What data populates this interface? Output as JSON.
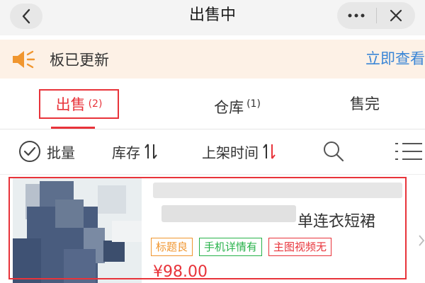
{
  "header": {
    "title": "出售中",
    "back_icon": "chevron-left-icon",
    "more_icon": "more-dots-icon",
    "close_icon": "close-icon"
  },
  "notice": {
    "icon": "speaker-icon",
    "text": "板已更新",
    "link": "立即查看",
    "icon_color": "#f0962f",
    "link_color": "#3a86d6"
  },
  "tabs": [
    {
      "label": "出售",
      "count": "(2)",
      "active": true
    },
    {
      "label": "仓库",
      "count": "(1)",
      "active": false
    },
    {
      "label": "售完",
      "count": "",
      "active": false
    }
  ],
  "toolbar": {
    "batch_label": "批量",
    "stock_label": "库存",
    "time_label": "上架时间",
    "search_icon": "search-icon",
    "menu_icon": "list-menu-icon"
  },
  "product": {
    "title_visible_suffix": "单连衣短裙",
    "tags": [
      "标题良",
      "手机详情有",
      "主图视频无"
    ],
    "price": "¥98.00"
  },
  "colors": {
    "accent_red": "#e8333a",
    "tag_orange": "#f0962f",
    "tag_green": "#27b24a"
  }
}
